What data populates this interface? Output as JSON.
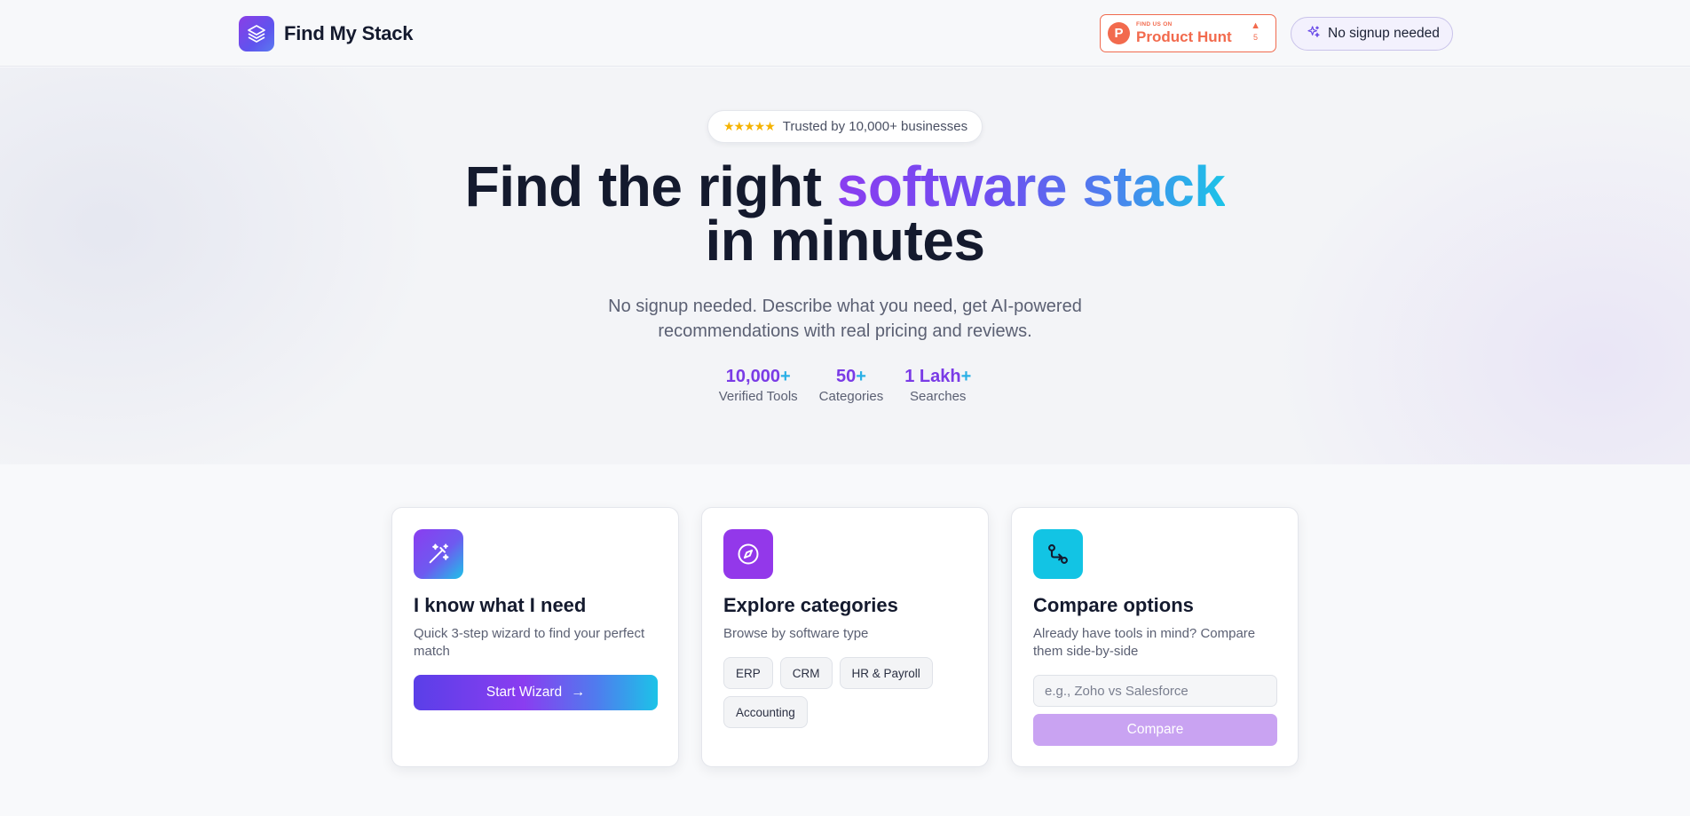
{
  "header": {
    "brand_name": "Find My Stack",
    "producthunt": {
      "small_label": "FIND US ON",
      "name": "Product Hunt",
      "votes": "5"
    },
    "nosignup_label": "No signup needed"
  },
  "hero": {
    "trust_text": "Trusted by 10,000+ businesses",
    "title_prefix": "Find the right ",
    "title_highlight": "software stack",
    "title_line2": "in minutes",
    "subtitle": "No signup needed. Describe what you need, get AI-powered recommendations with real pricing and reviews.",
    "stats": [
      {
        "value": "10,000",
        "plus": "+",
        "label": "Verified Tools"
      },
      {
        "value": "50",
        "plus": "+",
        "label": "Categories"
      },
      {
        "value": "1 Lakh",
        "plus": "+",
        "label": "Searches"
      }
    ]
  },
  "cards": {
    "wizard": {
      "title": "I know what I need",
      "description": "Quick 3-step wizard to find your perfect match",
      "button_label": "Start Wizard"
    },
    "explore": {
      "title": "Explore categories",
      "description": "Browse by software type",
      "chips": [
        "ERP",
        "CRM",
        "HR & Payroll",
        "Accounting"
      ]
    },
    "compare": {
      "title": "Compare options",
      "description": "Already have tools in mind? Compare them side-by-side",
      "input_placeholder": "e.g., Zoho vs Salesforce",
      "button_label": "Compare"
    }
  },
  "colors": {
    "accent_purple": "#7a3be6",
    "accent_cyan": "#1cc3e8",
    "producthunt_orange": "#f26a4d",
    "compare_button_disabled": "#c9a3f2"
  },
  "icons": {
    "brand": "layers-icon",
    "nosignup": "sparkles-icon",
    "wizard": "magic-wand-icon",
    "explore": "compass-icon",
    "compare": "git-compare-icon"
  }
}
